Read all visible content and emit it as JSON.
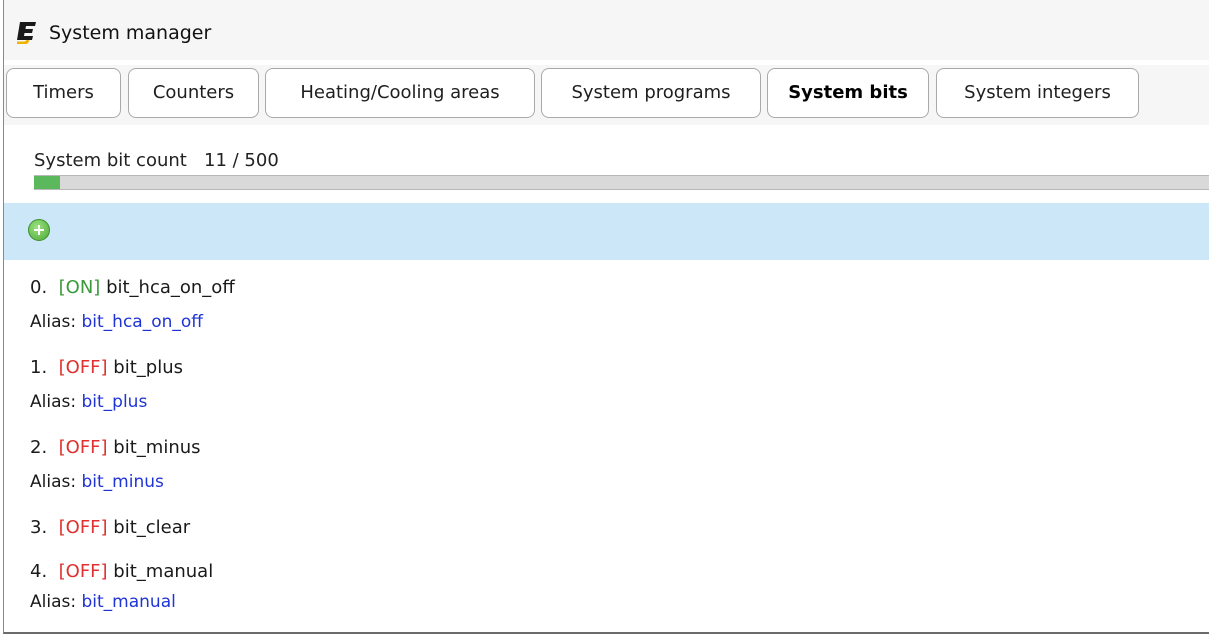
{
  "window": {
    "title": "System manager"
  },
  "tabs": [
    {
      "label": "Timers",
      "active": false
    },
    {
      "label": "Counters",
      "active": false
    },
    {
      "label": "Heating/Cooling areas",
      "active": false
    },
    {
      "label": "System programs",
      "active": false
    },
    {
      "label": "System bits",
      "active": true
    },
    {
      "label": "System integers",
      "active": false
    }
  ],
  "summary": {
    "label": "System bit count",
    "count": "11 / 500",
    "progress_fraction": 0.022
  },
  "toolbar": {
    "add_icon": "add-circle-icon"
  },
  "alias_label": "Alias:",
  "bits": [
    {
      "index": "0.",
      "state": "[ON]",
      "name": "bit_hca_on_off",
      "alias": "bit_hca_on_off"
    },
    {
      "index": "1.",
      "state": "[OFF]",
      "name": "bit_plus",
      "alias": "bit_plus"
    },
    {
      "index": "2.",
      "state": "[OFF]",
      "name": "bit_minus",
      "alias": "bit_minus"
    },
    {
      "index": "3.",
      "state": "[OFF]",
      "name": "bit_clear",
      "alias": ""
    },
    {
      "index": "4.",
      "state": "[OFF]",
      "name": "bit_manual",
      "alias": "bit_manual"
    }
  ],
  "colors": {
    "on": "#3a9a3a",
    "off": "#e03030",
    "alias": "#1f34d6",
    "progress": "#5cb85c",
    "toolbar": "#cce8f8"
  }
}
